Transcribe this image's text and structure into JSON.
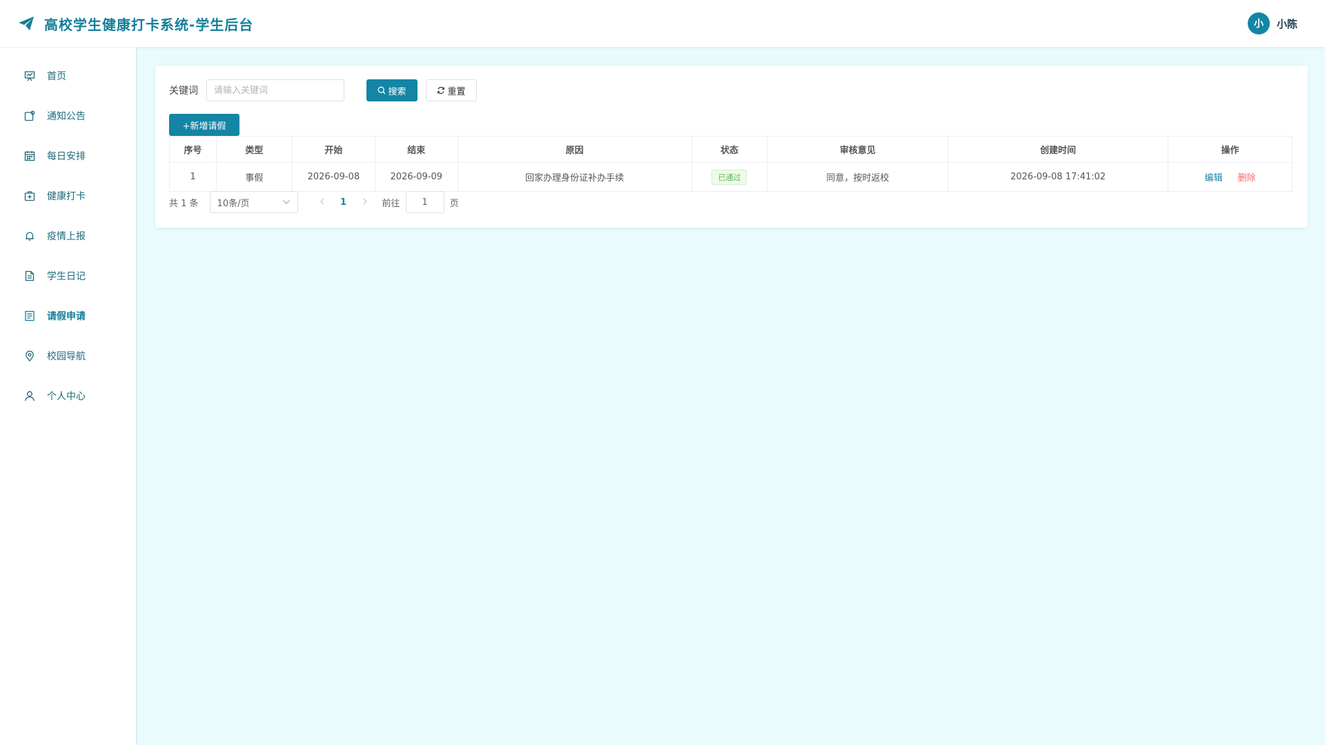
{
  "header": {
    "title": "高校学生健康打卡系统-学生后台",
    "avatar_text": "小",
    "username": "小陈"
  },
  "sidebar": {
    "items": [
      {
        "label": "首页",
        "icon": "chart-board-icon"
      },
      {
        "label": "通知公告",
        "icon": "notice-icon"
      },
      {
        "label": "每日安排",
        "icon": "calendar-icon"
      },
      {
        "label": "健康打卡",
        "icon": "medical-kit-icon"
      },
      {
        "label": "疫情上报",
        "icon": "bell-icon"
      },
      {
        "label": "学生日记",
        "icon": "document-icon"
      },
      {
        "label": "请假申请",
        "icon": "list-doc-icon",
        "active": true
      },
      {
        "label": "校园导航",
        "icon": "location-pin-icon"
      },
      {
        "label": "个人中心",
        "icon": "user-icon"
      }
    ]
  },
  "search": {
    "label": "关键词",
    "placeholder": "请输入关键词",
    "search_btn": "搜索",
    "reset_btn": "重置"
  },
  "toolbar": {
    "add_btn": "+新增请假"
  },
  "table": {
    "columns": [
      "序号",
      "类型",
      "开始",
      "结束",
      "原因",
      "状态",
      "审核意见",
      "创建时间",
      "操作"
    ],
    "rows": [
      {
        "index": "1",
        "type": "事假",
        "start": "2026-09-08",
        "end": "2026-09-09",
        "reason": "回家办理身份证补办手续",
        "status": "已通过",
        "review": "同意，按时返校",
        "created": "2026-09-08 17:41:02",
        "edit": "编辑",
        "delete": "删除"
      }
    ]
  },
  "pagination": {
    "total_text": "共 1 条",
    "page_size": "10条/页",
    "current_page": "1",
    "goto_label": "前往",
    "goto_value": "1",
    "goto_suffix": "页"
  },
  "colors": {
    "primary": "#1485a5",
    "background": "#e9fbfd",
    "success": "#5bb453",
    "danger": "#f56c6c"
  }
}
